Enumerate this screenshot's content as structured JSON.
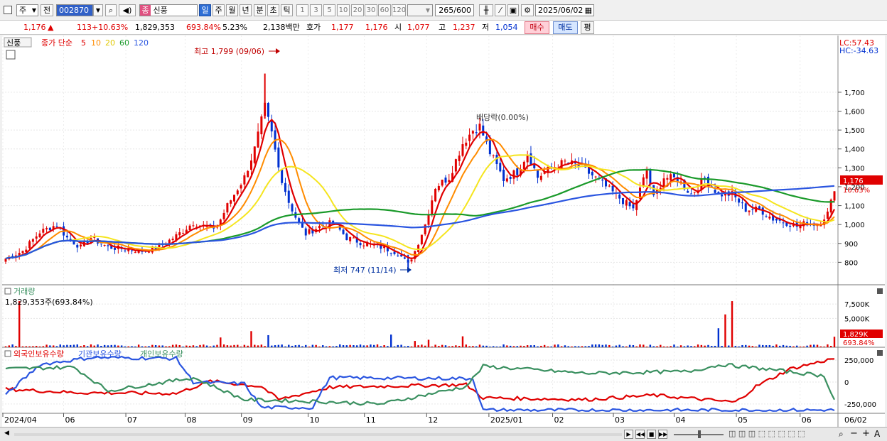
{
  "toolbar": {
    "market_label": "주",
    "prev_label": "전",
    "code": "002870",
    "stock_tag": "종",
    "stock_name": "신풍",
    "periods": [
      "일",
      "주",
      "월",
      "년",
      "분",
      "초",
      "틱"
    ],
    "intervals": [
      "1",
      "3",
      "5",
      "10",
      "20",
      "30",
      "60",
      "120"
    ],
    "count": "265",
    "count_total": "/600",
    "date": "2025/06/02"
  },
  "quote": {
    "price": "1,176",
    "arrow": "▲",
    "change": "113",
    "change_pct": "+10.63%",
    "volume": "1,829,353",
    "volume_pct": "693.84%",
    "turnover": "5.23%",
    "amount": "2,138백만",
    "ask_label": "호가",
    "ask": "1,177",
    "bid": "1,176",
    "open_label": "시",
    "open": "1,077",
    "high_label": "고",
    "high": "1,237",
    "low_label": "저",
    "low": "1,054",
    "buy_label": "매수",
    "sell_label": "매도",
    "eval_label": "평"
  },
  "colors": {
    "up": "#e00000",
    "down": "#0030d0",
    "ma5": "#e00000",
    "ma10": "#ff8c00",
    "ma20": "#f5e51e",
    "ma60": "#1a9a2a",
    "ma120": "#2a55e0",
    "foreign": "#e00000",
    "institution": "#2a55e0",
    "individual": "#3a9060"
  },
  "chart_data": [
    {
      "type": "candlestick",
      "title": "신풍",
      "legend": {
        "label": "종가 단순",
        "periods": [
          "5",
          "10",
          "20",
          "60",
          "120"
        ]
      },
      "right_top": [
        "LC:57.43",
        "HC:-34.63"
      ],
      "current_label": "1,176",
      "current_pct": "10.63%",
      "y_ticks": [
        "1,700",
        "1,600",
        "1,500",
        "1,400",
        "1,300",
        "1,200",
        "1,100",
        "1,000",
        "900",
        "800"
      ],
      "ylim": [
        700,
        1850
      ],
      "high_annotation": "최고 1,799 (09/06)",
      "low_annotation": "최저 747 (11/14)",
      "event_annotation": "배당락(0.00%)",
      "x_ticks": [
        "2024/04",
        "06",
        "07",
        "08",
        "09",
        "10",
        "11",
        "12",
        "2025/01",
        "02",
        "03",
        "04",
        "05",
        "06"
      ],
      "right_x_label": "06/02",
      "series_points": [
        [
          0,
          820
        ],
        [
          5,
          860
        ],
        [
          10,
          960
        ],
        [
          15,
          1000
        ],
        [
          18,
          930
        ],
        [
          22,
          880
        ],
        [
          25,
          930
        ],
        [
          30,
          880
        ],
        [
          35,
          870
        ],
        [
          40,
          860
        ],
        [
          45,
          880
        ],
        [
          50,
          940
        ],
        [
          55,
          1010
        ],
        [
          60,
          980
        ],
        [
          62,
          990
        ],
        [
          65,
          1100
        ],
        [
          70,
          1250
        ],
        [
          73,
          1400
        ],
        [
          76,
          1620
        ],
        [
          78,
          1480
        ],
        [
          80,
          1300
        ],
        [
          83,
          1120
        ],
        [
          86,
          1000
        ],
        [
          88,
          950
        ],
        [
          92,
          990
        ],
        [
          96,
          1010
        ],
        [
          100,
          930
        ],
        [
          105,
          900
        ],
        [
          110,
          880
        ],
        [
          115,
          850
        ],
        [
          118,
          790
        ],
        [
          120,
          860
        ],
        [
          123,
          1000
        ],
        [
          126,
          1200
        ],
        [
          130,
          1250
        ],
        [
          134,
          1430
        ],
        [
          137,
          1500
        ],
        [
          139,
          1520
        ],
        [
          142,
          1380
        ],
        [
          146,
          1240
        ],
        [
          150,
          1280
        ],
        [
          153,
          1380
        ],
        [
          156,
          1250
        ],
        [
          160,
          1300
        ],
        [
          164,
          1330
        ],
        [
          168,
          1310
        ],
        [
          172,
          1260
        ],
        [
          176,
          1200
        ],
        [
          180,
          1140
        ],
        [
          184,
          1080
        ],
        [
          188,
          1290
        ],
        [
          190,
          1140
        ],
        [
          193,
          1250
        ],
        [
          197,
          1240
        ],
        [
          201,
          1160
        ],
        [
          205,
          1240
        ],
        [
          209,
          1160
        ],
        [
          213,
          1160
        ],
        [
          217,
          1080
        ],
        [
          221,
          1080
        ],
        [
          225,
          1030
        ],
        [
          229,
          1010
        ],
        [
          232,
          990
        ],
        [
          235,
          1010
        ],
        [
          238,
          1000
        ],
        [
          241,
          1060
        ],
        [
          243,
          1176
        ]
      ]
    },
    {
      "type": "bar",
      "title": "거래량",
      "value_label": "1,829,353주(693.84%)",
      "y_ticks": [
        "7,500K",
        "5,000K"
      ],
      "current_label": "1,829K",
      "current_pct": "693.84%",
      "spikes": [
        [
          4,
          8000
        ],
        [
          63,
          1700
        ],
        [
          72,
          2800
        ],
        [
          77,
          2100
        ],
        [
          113,
          2200
        ],
        [
          120,
          1100
        ],
        [
          124,
          1300
        ],
        [
          134,
          1900
        ],
        [
          209,
          3300
        ],
        [
          211,
          5700
        ],
        [
          213,
          8000
        ],
        [
          243,
          1829
        ]
      ]
    },
    {
      "type": "line",
      "series": [
        {
          "name": "외국인보유수량"
        },
        {
          "name": "기관보유수량"
        },
        {
          "name": "개인보유수량"
        }
      ],
      "y_ticks": [
        "250,000",
        "0",
        "-250,000"
      ]
    }
  ]
}
